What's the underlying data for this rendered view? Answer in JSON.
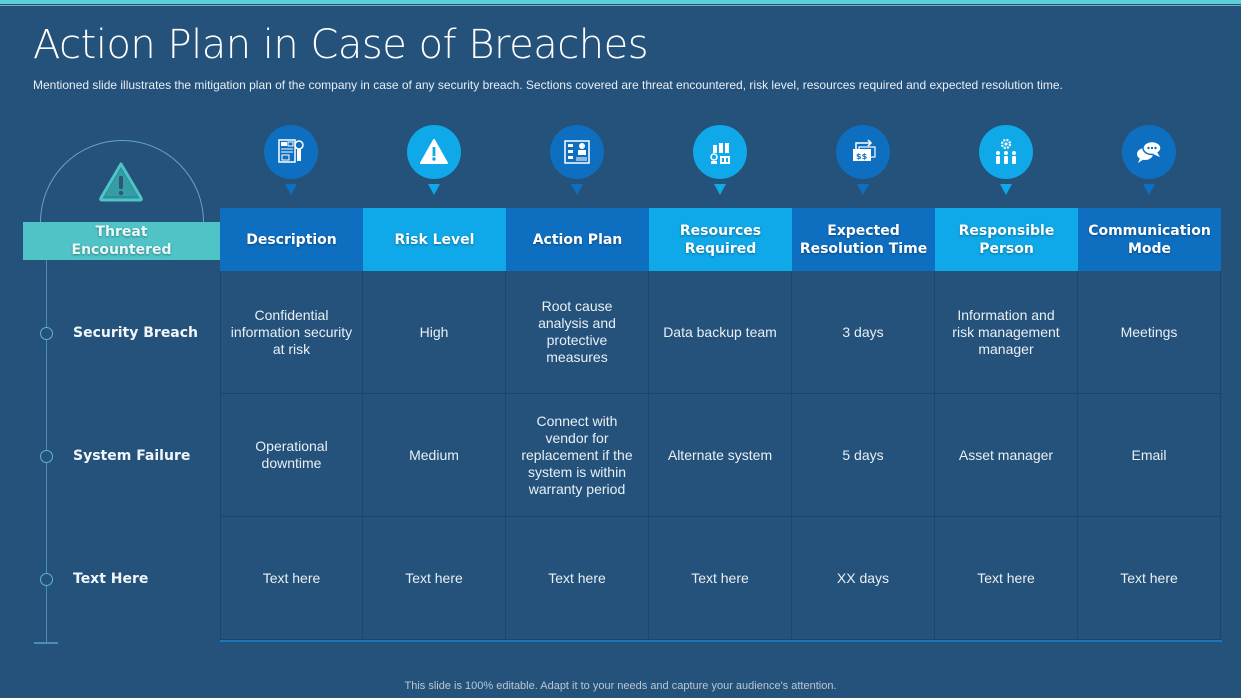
{
  "slide": {
    "title": "Action Plan in Case of Breaches",
    "subtitle": "Mentioned slide illustrates the mitigation plan of the company in case of any security breach. Sections covered  are threat encountered, risk level, resources required and expected resolution time.",
    "footer": "This slide is 100% editable. Adapt it to your needs and capture your audience's attention."
  },
  "colors": {
    "background": "#24527a",
    "accent_teal": "#4fc3c6",
    "header_dark": "#0e6fc1",
    "header_light": "#0fa8e8"
  },
  "threat": {
    "header": "Threat\nEncountered",
    "icon": "warning-triangle-icon"
  },
  "columns": [
    {
      "label": "Description",
      "icon": "document-report-icon",
      "style": "dark"
    },
    {
      "label": "Risk Level",
      "icon": "warning-icon",
      "style": "light"
    },
    {
      "label": "Action Plan",
      "icon": "flowchart-person-icon",
      "style": "dark"
    },
    {
      "label": "Resources Required",
      "icon": "factory-resources-icon",
      "style": "light"
    },
    {
      "label": "Expected Resolution Time",
      "icon": "money-transfer-icon",
      "style": "dark"
    },
    {
      "label": "Responsible Person",
      "icon": "team-gear-icon",
      "style": "light"
    },
    {
      "label": "Communication Mode",
      "icon": "chat-bubbles-icon",
      "style": "dark"
    }
  ],
  "rows": [
    {
      "threat": "Security Breach",
      "cells": [
        "Confidential\ninformation security\nat risk",
        "High",
        "Root cause\nanalysis and\nprotective\nmeasures",
        "Data backup team",
        "3 days",
        "Information and\nrisk management\nmanager",
        "Meetings"
      ]
    },
    {
      "threat": "System Failure",
      "cells": [
        "Operational\ndowntime",
        "Medium",
        "Connect with\nvendor for\nreplacement if the\nsystem is within\nwarranty period",
        "Alternate  system",
        "5 days",
        "Asset manager",
        "Email"
      ]
    },
    {
      "threat": "Text Here",
      "cells": [
        "Text here",
        "Text here",
        "Text here",
        "Text here",
        "XX  days",
        "Text here",
        "Text here"
      ]
    }
  ]
}
